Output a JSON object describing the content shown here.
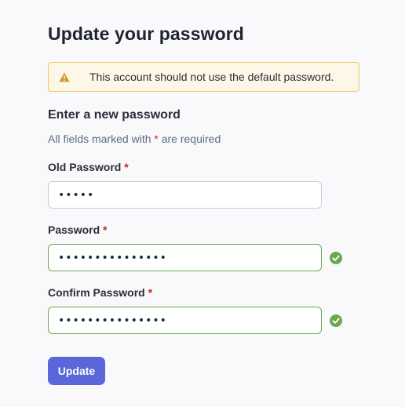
{
  "page": {
    "title": "Update your password"
  },
  "alert": {
    "icon": "warning-icon",
    "message": "This account should not use the default password."
  },
  "form": {
    "heading": "Enter a new password",
    "required_note_prefix": "All fields marked with",
    "required_marker": "*",
    "required_note_suffix": "are required",
    "fields": {
      "old_password": {
        "label": "Old Password",
        "value": "•••••",
        "valid": false
      },
      "password": {
        "label": "Password",
        "value": "•••••••••••••••",
        "valid": true,
        "status_icon": "check-circle-icon"
      },
      "confirm_password": {
        "label": "Confirm Password",
        "value": "•••••••••••••••",
        "valid": true,
        "status_icon": "check-circle-icon"
      }
    },
    "submit_label": "Update"
  },
  "colors": {
    "accent": "#5b67d8",
    "valid": "#6aa84f",
    "warning_bg": "#fdf7e7",
    "warning_border": "#f1c55e",
    "warning_icon": "#c99a2e",
    "required": "#c5281c"
  }
}
